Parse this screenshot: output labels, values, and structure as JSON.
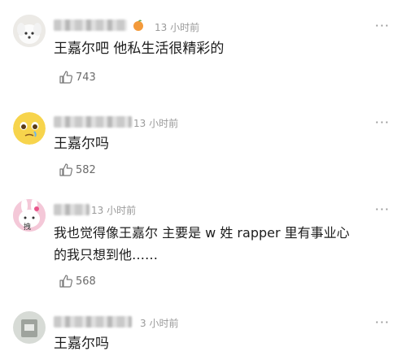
{
  "comments": [
    {
      "time": "13 小时前",
      "text": "王嘉尔吧 他私生活很精彩的",
      "likes": "743",
      "more": "···"
    },
    {
      "time": "13 小时前",
      "text": "王嘉尔吗",
      "likes": "582",
      "more": "···"
    },
    {
      "time": "13 小时前",
      "text_line1": "我也觉得像王嘉尔 主要是 w 姓 rapper 里有事业心",
      "text_line2": "的我只想到他……",
      "likes": "568",
      "more": "···",
      "avatar_tag": "拽"
    },
    {
      "time": "3 小时前",
      "text": "王嘉尔吗",
      "more": "···"
    }
  ]
}
